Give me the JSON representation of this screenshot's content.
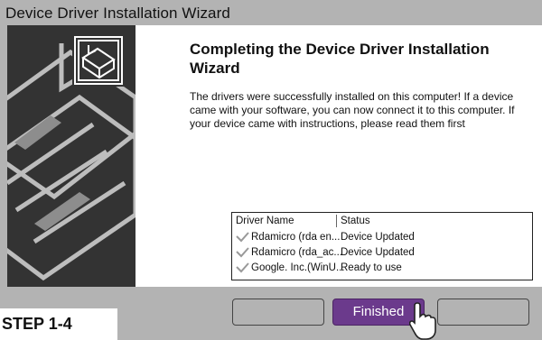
{
  "window": {
    "title": "Device Driver Installation Wizard"
  },
  "main": {
    "heading": "Completing the Device Driver Installation Wizard",
    "description": "The drivers were successfully installed on this computer! If a device came with your software, you can now connect it to this computer. If your device came with instructions, please read them first"
  },
  "driver_table": {
    "headers": {
      "name": "Driver Name",
      "status": "Status"
    },
    "rows": [
      {
        "name": "Rdamicro (rda en...",
        "status": "Device Updated",
        "icon": "check-icon"
      },
      {
        "name": "Rdamicro (rda_ac...",
        "status": "Device Updated",
        "icon": "check-icon"
      },
      {
        "name": "Google. Inc.(WinU...",
        "status": "Ready to use",
        "icon": "check-icon"
      }
    ]
  },
  "buttons": {
    "back_label": "",
    "finish_label": "Finished",
    "cancel_label": ""
  },
  "step_label": "STEP 1-4",
  "colors": {
    "chrome": "#b3b3b3",
    "side_panel": "#333333",
    "finish_button": "#6b3a8c"
  }
}
